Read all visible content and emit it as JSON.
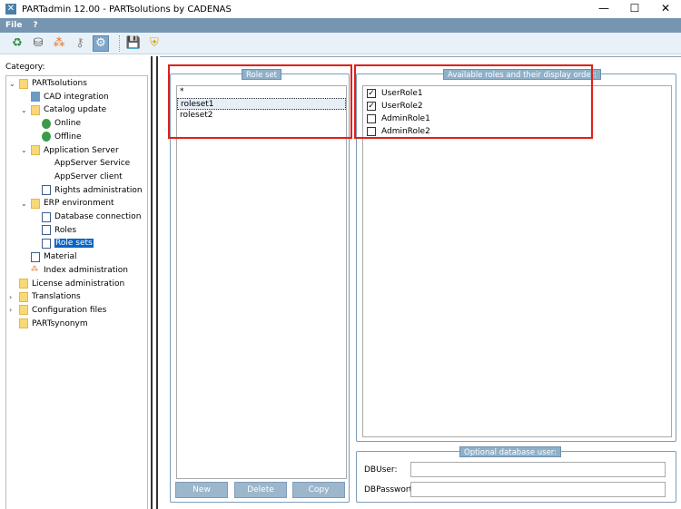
{
  "window": {
    "title": "PARTadmin 12.00 - PARTsolutions by CADENAS",
    "minimize": "—",
    "maximize": "☐",
    "close": "✕"
  },
  "menu": [
    "File",
    "?"
  ],
  "toolbar": {
    "icons": [
      "sync-icon",
      "server-icon",
      "tree-icon",
      "keys-icon",
      "gear-icon",
      "save-icon",
      "shield-icon"
    ],
    "active": "gear-icon"
  },
  "sidebar": {
    "label": "Category:",
    "items": [
      {
        "label": "PARTsolutions",
        "level": 0,
        "icon": "folder",
        "state": "expanded"
      },
      {
        "label": "CAD integration",
        "level": 1,
        "icon": "gear"
      },
      {
        "label": "Catalog update",
        "level": 1,
        "icon": "folder",
        "state": "expanded"
      },
      {
        "label": "Online",
        "level": 2,
        "icon": "globe"
      },
      {
        "label": "Offline",
        "level": 2,
        "icon": "globe"
      },
      {
        "label": "Application Server",
        "level": 1,
        "icon": "folder",
        "state": "expanded"
      },
      {
        "label": "AppServer Service",
        "level": 2,
        "icon": "server"
      },
      {
        "label": "AppServer client",
        "level": 2,
        "icon": "server"
      },
      {
        "label": "Rights administration",
        "level": 2,
        "icon": "doc"
      },
      {
        "label": "ERP environment",
        "level": 1,
        "icon": "folder",
        "state": "expanded"
      },
      {
        "label": "Database connection",
        "level": 2,
        "icon": "doc"
      },
      {
        "label": "Roles",
        "level": 2,
        "icon": "doc"
      },
      {
        "label": "Role sets",
        "level": 2,
        "icon": "doc",
        "selected": true
      },
      {
        "label": "Material",
        "level": 1,
        "icon": "doc"
      },
      {
        "label": "Index administration",
        "level": 1,
        "icon": "tree"
      },
      {
        "label": "License administration",
        "level": 0,
        "icon": "folder"
      },
      {
        "label": "Translations",
        "level": 0,
        "icon": "folder",
        "state": "collapsed"
      },
      {
        "label": "Configuration files",
        "level": 0,
        "icon": "folder",
        "state": "collapsed"
      },
      {
        "label": "PARTsynonym",
        "level": 0,
        "icon": "folder"
      }
    ]
  },
  "roleset": {
    "legend": "Role set",
    "items": [
      "*",
      "roleset1",
      "roleset2"
    ],
    "selected": "roleset1",
    "buttons": {
      "new": "New",
      "delete": "Delete",
      "copy": "Copy"
    }
  },
  "roles": {
    "legend": "Available roles and their display order:",
    "items": [
      {
        "label": "UserRole1",
        "checked": true
      },
      {
        "label": "UserRole2",
        "checked": true
      },
      {
        "label": "AdminRole1",
        "checked": false
      },
      {
        "label": "AdminRole2",
        "checked": false
      }
    ]
  },
  "dbuser": {
    "legend": "Optional database user:",
    "user_label": "DBUser:",
    "password_label": "DBPasswort:",
    "user_value": "",
    "password_value": ""
  },
  "colors": {
    "highlight": "#e0201a",
    "menubar": "#7595b1",
    "selection": "#0a64c8"
  }
}
